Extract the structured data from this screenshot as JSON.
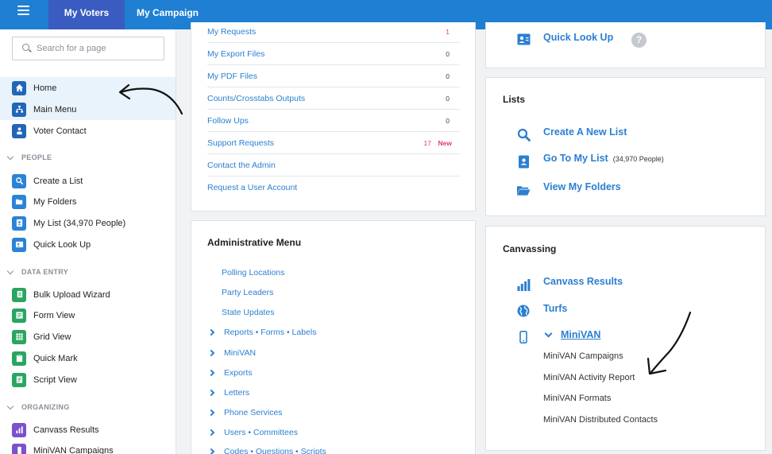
{
  "topbar": {
    "tabs": [
      {
        "label": "My Voters"
      },
      {
        "label": "My Campaign"
      }
    ]
  },
  "sidebar": {
    "search_placeholder": "Search for a page",
    "items": [
      {
        "label": "Home"
      },
      {
        "label": "Main Menu"
      },
      {
        "label": "Voter Contact"
      }
    ],
    "sections": [
      {
        "title": "PEOPLE",
        "items": [
          {
            "label": "Create a List"
          },
          {
            "label": "My Folders"
          },
          {
            "label": "My List (34,970 People)"
          },
          {
            "label": "Quick Look Up"
          }
        ]
      },
      {
        "title": "DATA ENTRY",
        "items": [
          {
            "label": "Bulk Upload Wizard"
          },
          {
            "label": "Form View"
          },
          {
            "label": "Grid View"
          },
          {
            "label": "Quick Mark"
          },
          {
            "label": "Script View"
          }
        ]
      },
      {
        "title": "ORGANIZING",
        "items": [
          {
            "label": "Canvass Results"
          },
          {
            "label": "MiniVAN Campaigns"
          }
        ]
      }
    ]
  },
  "reports": {
    "rows": [
      {
        "label": "My Requests",
        "count": "1"
      },
      {
        "label": "My Export Files",
        "count": "0"
      },
      {
        "label": "My PDF Files",
        "count": "0"
      },
      {
        "label": "Counts/Crosstabs Outputs",
        "count": "0"
      },
      {
        "label": "Follow Ups",
        "count": "0"
      },
      {
        "label": "Support Requests",
        "count": "17",
        "badge": "New"
      },
      {
        "label": "Contact the Admin"
      },
      {
        "label": "Request a User Account"
      }
    ]
  },
  "admin": {
    "title": "Administrative Menu",
    "links": [
      "Polling Locations",
      "Party Leaders",
      "State Updates"
    ],
    "expandables": [
      "Reports • Forms • Labels",
      "MiniVAN",
      "Exports",
      "Letters",
      "Phone Services",
      "Users • Committees",
      "Codes • Questions • Scripts"
    ]
  },
  "quick": {
    "label": "Quick Look Up",
    "help": "?"
  },
  "lists": {
    "title": "Lists",
    "create": "Create A New List",
    "goto": "Go To My List",
    "goto_note": "(34,970 People)",
    "folders": "View My Folders"
  },
  "canvassing": {
    "title": "Canvassing",
    "results": "Canvass Results",
    "turfs": "Turfs",
    "minivan": "MiniVAN",
    "minivan_items": [
      "MiniVAN Campaigns",
      "MiniVAN Activity Report",
      "MiniVAN Formats",
      "MiniVAN Distributed Contacts"
    ]
  },
  "colors": {
    "topbar": "#1e7fd3",
    "active_tab": "#3a5cc1",
    "link": "#2b7fd1",
    "new_badge": "#e0397a",
    "highlight": "#e8f3fc"
  }
}
